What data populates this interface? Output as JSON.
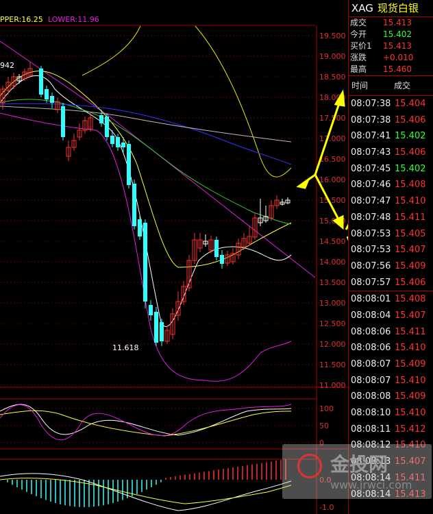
{
  "chart": {
    "boll_label": "PPER:16.25",
    "lower_label": "LOWER:11.96",
    "left_value": "942",
    "low_value": "11.618",
    "price_axis": [
      "19.500",
      "19.000",
      "18.500",
      "18.000",
      "17.500",
      "17.000",
      "16.500",
      "16.000",
      "15.500",
      "15.000",
      "14.500",
      "14.000",
      "13.500",
      "13.000",
      "12.500",
      "12.000",
      "11.500",
      "11.000"
    ],
    "kdj_axis": [
      "100",
      "50",
      "0"
    ],
    "macd_axis": [
      "0.0",
      "-1.0"
    ],
    "colors": {
      "up": "#ff3030",
      "down": "#30ffff",
      "mid": "#ffffff",
      "upper": "#e6e600",
      "lower": "#e020e0",
      "ma1": "#ffffff",
      "ma2": "#ffff33",
      "ma3": "#33cc33",
      "ma4": "#2222ff",
      "ma5": "#bbbbbb",
      "arrow": "#ffff00"
    }
  },
  "panel": {
    "symbol": "XAG",
    "name": "现货白银",
    "quote": [
      {
        "label": "成交",
        "value": "15.413",
        "up": false
      },
      {
        "label": "今开",
        "value": "15.402",
        "up": true
      },
      {
        "label": "买价1",
        "value": "15.413",
        "up": false
      },
      {
        "label": "涨跌",
        "value": "+0.010",
        "up": false
      },
      {
        "label": "最高",
        "value": "15.460",
        "up": false
      }
    ],
    "ticks_header": {
      "time": "时间",
      "deal": "成交"
    },
    "ticks": [
      {
        "time": "08:07:38",
        "price": "15.404",
        "g": false
      },
      {
        "time": "08:07:38",
        "price": "15.406",
        "g": false
      },
      {
        "time": "08:07:41",
        "price": "15.402",
        "g": true
      },
      {
        "time": "08:07:43",
        "price": "15.406",
        "g": false
      },
      {
        "time": "08:07:45",
        "price": "15.402",
        "g": true
      },
      {
        "time": "08:07:46",
        "price": "15.408",
        "g": false
      },
      {
        "time": "08:07:47",
        "price": "15.410",
        "g": false
      },
      {
        "time": "08:07:48",
        "price": "15.411",
        "g": false
      },
      {
        "time": "08:07:53",
        "price": "15.405",
        "g": false
      },
      {
        "time": "08:07:53",
        "price": "15.407",
        "g": false
      },
      {
        "time": "08:07:56",
        "price": "15.409",
        "g": false
      },
      {
        "time": "08:07:57",
        "price": "15.406",
        "g": false
      },
      {
        "time": "08:08:01",
        "price": "15.408",
        "g": false
      },
      {
        "time": "08:08:04",
        "price": "15.407",
        "g": false
      },
      {
        "time": "08:08:06",
        "price": "15.411",
        "g": false
      },
      {
        "time": "08:08:06",
        "price": "15.410",
        "g": false
      },
      {
        "time": "08:08:07",
        "price": "15.409",
        "g": false
      },
      {
        "time": "08:08:07",
        "price": "15.410",
        "g": false
      },
      {
        "time": "08:08:08",
        "price": "15.409",
        "g": false
      },
      {
        "time": "08:08:10",
        "price": "15.410",
        "g": false
      },
      {
        "time": "08:08:11",
        "price": "15.412",
        "g": false
      },
      {
        "time": "08:08:12",
        "price": "15.410",
        "g": false
      },
      {
        "time": "08:08:13",
        "price": "15.407",
        "g": false
      },
      {
        "time": "08:08:14",
        "price": "15.411",
        "g": false
      },
      {
        "time": "08:08:14",
        "price": "15.413",
        "g": false
      }
    ]
  },
  "watermark": {
    "name": "金投网",
    "url": "www.jrwci.com"
  }
}
